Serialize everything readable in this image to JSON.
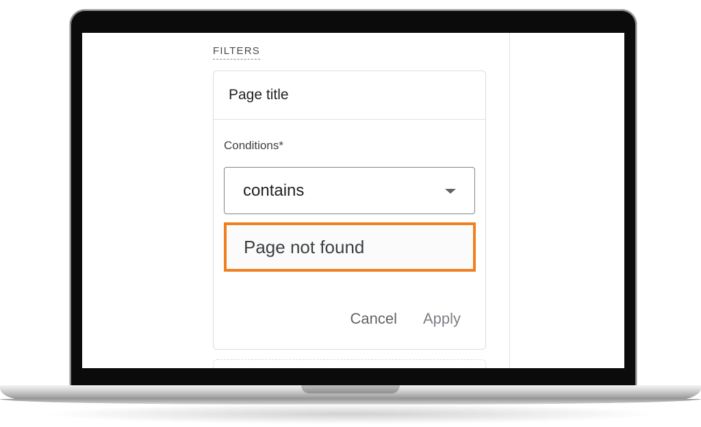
{
  "filters": {
    "section_label": "FILTERS",
    "card": {
      "title": "Page title",
      "conditions_label": "Conditions*",
      "condition_selected": "contains",
      "value": "Page not found",
      "cancel_label": "Cancel",
      "apply_label": "Apply"
    }
  },
  "icons": {
    "dropdown": "caret-down-icon"
  },
  "colors": {
    "highlight_border": "#f07f1e"
  }
}
